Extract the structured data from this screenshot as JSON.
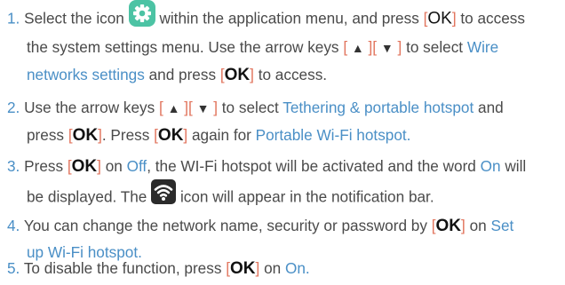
{
  "colors": {
    "text": "#4a4a4a",
    "highlight": "#4a8fc6",
    "bracket": "#e2765f",
    "ok_key": "#111111",
    "settings_icon_bg": "#4cc3a4",
    "wifi_icon_bg": "#2b2b2b"
  },
  "icons": {
    "settings": "settings-gear-icon",
    "hotspot": "wifi-hotspot-icon",
    "arrow_up": "▲",
    "arrow_down": "▼"
  },
  "keys": {
    "ok": "OK",
    "ok_alt": "OK"
  },
  "steps": [
    {
      "number": "1.",
      "t1": "Select the icon",
      "t2": "within the application menu, and press",
      "t3": "to access",
      "t4": "the system settings menu. Use the arrow keys",
      "t5": "to select",
      "h1": "Wire",
      "h2": "networks settings",
      "t6": "and press",
      "t7": "to access."
    },
    {
      "number": "2.",
      "t1": "Use the arrow keys",
      "t2": "to select",
      "h1": "Tethering & portable hotspot",
      "t3": "and",
      "t4": "press",
      "t5": ". Press",
      "t6": "again for",
      "h2": "Portable Wi-Fi hotspot."
    },
    {
      "number": "3.",
      "t1": "Press",
      "t2": "on",
      "h1": "Off",
      "t3": ", the WI-Fi hotspot will be activated and the word",
      "h2": "On",
      "t4": "will",
      "t5": "be displayed. The",
      "t6": "icon will appear in the notification bar."
    },
    {
      "number": "4.",
      "t1": "You can change the network name, security or password by",
      "t2": "on",
      "h1": "Set",
      "h2": "up Wi-Fi hotspot."
    },
    {
      "number": "5.",
      "t1": "To disable the function, press",
      "t2": "on",
      "h1": "On."
    }
  ]
}
